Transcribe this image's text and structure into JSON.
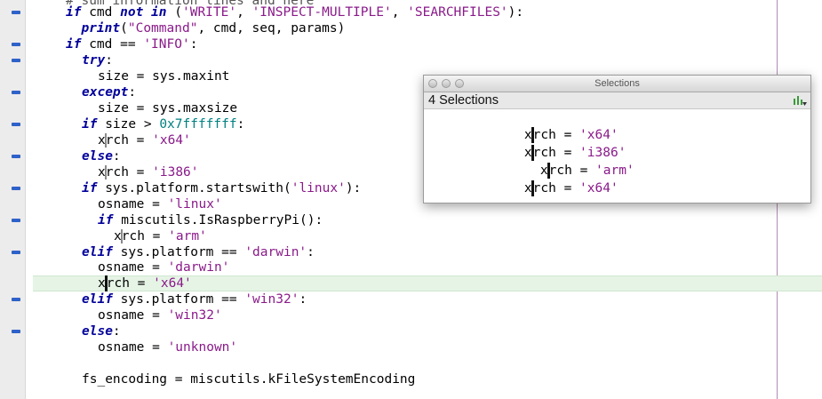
{
  "panel": {
    "title": "Selections",
    "count_label": "4 Selections",
    "items": [
      {
        "left": "x",
        "right": "rch = ",
        "value": "'x64'"
      },
      {
        "left": "x",
        "right": "rch = ",
        "value": "'i386'"
      },
      {
        "left": "x",
        "right": "rch = ",
        "value": "'arm'"
      },
      {
        "left": "x",
        "right": "rch = ",
        "value": "'x64'"
      }
    ]
  },
  "code": {
    "l0": {
      "a": "# sum information lines and here",
      "b": ""
    },
    "l1": {
      "kw1": "if",
      "t1": " cmd ",
      "kw2": "not in",
      "t2": " (",
      "s1": "'WRITE'",
      "t3": ", ",
      "s2": "'INSPECT-MULTIPLE'",
      "t4": ", ",
      "s3": "'SEARCHFILES'",
      "t5": "):"
    },
    "l2": {
      "kw1": "print",
      "t1": "(",
      "s1": "\"Command\"",
      "t2": ", cmd, seq, params)"
    },
    "l3": {
      "kw1": "if",
      "t1": " cmd == ",
      "s1": "'INFO'",
      "t2": ":"
    },
    "l4": {
      "kw1": "try",
      "t1": ":"
    },
    "l5": {
      "t1": "size = sys.maxint"
    },
    "l6": {
      "kw1": "except",
      "t1": ":"
    },
    "l7": {
      "t1": "size = sys.maxsize"
    },
    "l8": {
      "kw1": "if",
      "t1": " size > ",
      "n1": "0x7fffffff",
      "t2": ":"
    },
    "l9": {
      "a": "x",
      "b": "rch = ",
      "s1": "'x64'"
    },
    "l10": {
      "kw1": "else",
      "t1": ":"
    },
    "l11": {
      "a": "x",
      "b": "rch = ",
      "s1": "'i386'"
    },
    "l12": {
      "kw1": "if",
      "t1": " sys.platform.startswith(",
      "s1": "'linux'",
      "t2": "):"
    },
    "l13": {
      "t1": "osname = ",
      "s1": "'linux'"
    },
    "l14": {
      "kw1": "if",
      "t1": " miscutils.IsRaspberryPi():"
    },
    "l15": {
      "a": "x",
      "b": "rch = ",
      "s1": "'arm'"
    },
    "l16": {
      "kw1": "elif",
      "t1": " sys.platform == ",
      "s1": "'darwin'",
      "t2": ":"
    },
    "l17": {
      "t1": "osname = ",
      "s1": "'darwin'"
    },
    "l18": {
      "a": "x",
      "b": "rch = ",
      "s1": "'x64'"
    },
    "l19": {
      "kw1": "elif",
      "t1": " sys.platform == ",
      "s1": "'win32'",
      "t2": ":"
    },
    "l20": {
      "t1": "osname = ",
      "s1": "'win32'"
    },
    "l21": {
      "kw1": "else",
      "t1": ":"
    },
    "l22": {
      "t1": "osname = ",
      "s1": "'unknown'"
    },
    "l24": {
      "t1": "fs_encoding = miscutils.kFileSystemEncoding"
    }
  },
  "colors": {
    "keyword": "#00009a",
    "string": "#8a1a8a",
    "number": "#008080",
    "current_line": "#e6f4e6",
    "fold_marker": "#2f62c8"
  }
}
